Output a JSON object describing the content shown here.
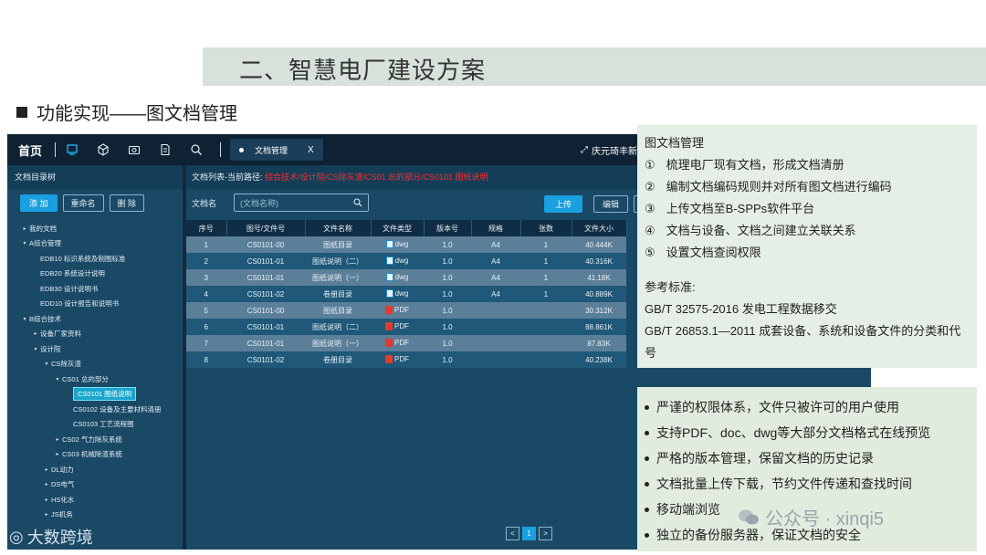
{
  "slide": {
    "title": "二、智慧电厂建设方案",
    "section": "功能实现——图文档管理"
  },
  "app": {
    "home_label": "首页",
    "tab_label": "文档管理",
    "tab_close": "X",
    "user_label": "庆元琦丰新",
    "left_panel": {
      "title": "文档目录树",
      "buttons": {
        "add": "添 加",
        "rename": "重命名",
        "delete": "删 除"
      },
      "tree": [
        {
          "label": "我的文档",
          "indent": 0,
          "arrow": "▸"
        },
        {
          "label": "A综合管理",
          "indent": 0,
          "arrow": "▾"
        },
        {
          "label": "EDB10 标识系统及制图标准",
          "indent": 1,
          "arrow": ""
        },
        {
          "label": "EDB20 系统设计说明",
          "indent": 1,
          "arrow": ""
        },
        {
          "label": "EDB30 设计说明书",
          "indent": 1,
          "arrow": ""
        },
        {
          "label": "EDD10 设计报告和说明书",
          "indent": 1,
          "arrow": ""
        },
        {
          "label": "B综合技术",
          "indent": 0,
          "arrow": "▾"
        },
        {
          "label": "设备厂家资料",
          "indent": 1,
          "arrow": "▸"
        },
        {
          "label": "设计院",
          "indent": 1,
          "arrow": "▾"
        },
        {
          "label": "CS除灰渣",
          "indent": 2,
          "arrow": "▾"
        },
        {
          "label": "CS01 总的部分",
          "indent": 3,
          "arrow": "▾"
        },
        {
          "label": "CS0101 图纸说明",
          "indent": 4,
          "arrow": "",
          "selected": true
        },
        {
          "label": "CS0102 设备及主要材料清册",
          "indent": 4,
          "arrow": ""
        },
        {
          "label": "CS0103 工艺流程图",
          "indent": 4,
          "arrow": ""
        },
        {
          "label": "CS02 气力除灰系统",
          "indent": 3,
          "arrow": "▸"
        },
        {
          "label": "CS03 机械除渣系统",
          "indent": 3,
          "arrow": "▸"
        },
        {
          "label": "DL动力",
          "indent": 2,
          "arrow": "▸"
        },
        {
          "label": "DS电气",
          "indent": 2,
          "arrow": "▸"
        },
        {
          "label": "HS化水",
          "indent": 2,
          "arrow": "▸"
        },
        {
          "label": "JS机务",
          "indent": 2,
          "arrow": "▸"
        }
      ]
    },
    "right_panel": {
      "header_prefix": "文档列表-当前路径:",
      "header_path": "综合技术/设计院/CS除灰渣/CS01 总的部分/CS0101 图纸说明",
      "search_label": "文档名",
      "search_placeholder": "(文档名称)",
      "upload_label": "上传",
      "edit_label": "编辑",
      "columns": [
        "序号",
        "图号/文件号",
        "文件名称",
        "文件类型",
        "版本号",
        "规格",
        "张数",
        "文件大小"
      ],
      "rows": [
        {
          "no": "1",
          "code": "CS0101-00",
          "name": "图纸目录",
          "type": "dwg",
          "ver": "1.0",
          "spec": "A4",
          "pages": "1",
          "size": "40.444K"
        },
        {
          "no": "2",
          "code": "CS0101-01",
          "name": "图纸说明（二）",
          "type": "dwg",
          "ver": "1.0",
          "spec": "A4",
          "pages": "1",
          "size": "40.316K"
        },
        {
          "no": "3",
          "code": "CS0101-01",
          "name": "图纸说明（一）",
          "type": "dwg",
          "ver": "1.0",
          "spec": "A4",
          "pages": "1",
          "size": "41.18K"
        },
        {
          "no": "4",
          "code": "CS0101-02",
          "name": "卷册目录",
          "type": "dwg",
          "ver": "1.0",
          "spec": "A4",
          "pages": "1",
          "size": "40.889K"
        },
        {
          "no": "5",
          "code": "CS0101-00",
          "name": "图纸目录",
          "type": "PDF",
          "ver": "1.0",
          "spec": "",
          "pages": "",
          "size": "30.312K"
        },
        {
          "no": "6",
          "code": "CS0101-01",
          "name": "图纸说明（二）",
          "type": "PDF",
          "ver": "1.0",
          "spec": "",
          "pages": "",
          "size": "88.861K"
        },
        {
          "no": "7",
          "code": "CS0101-01",
          "name": "图纸说明（一）",
          "type": "PDF",
          "ver": "1.0",
          "spec": "",
          "pages": "",
          "size": "87.83K"
        },
        {
          "no": "8",
          "code": "CS0101-02",
          "name": "卷册目录",
          "type": "PDF",
          "ver": "1.0",
          "spec": "",
          "pages": "",
          "size": "40.238K"
        }
      ],
      "pager": {
        "prev": "<",
        "current": "1",
        "next": ">"
      }
    }
  },
  "info": {
    "title": "图文档管理",
    "items": [
      {
        "num": "①",
        "text": "梳理电厂现有文档，形成文档清册"
      },
      {
        "num": "②",
        "text": "编制文档编码规则并对所有图文档进行编码"
      },
      {
        "num": "③",
        "text": "上传文档至B-SPPs软件平台"
      },
      {
        "num": "④",
        "text": "文档与设备、文档之间建立关联关系"
      },
      {
        "num": "⑤",
        "text": "设置文档查阅权限"
      }
    ],
    "ref_title": "参考标准:",
    "refs": [
      "GB/T 32575-2016 发电工程数据移交",
      "GB/T 26853.1—2011 成套设备、系统和设备文件的分类和代号"
    ]
  },
  "features": [
    "严谨的权限体系，文件只被许可的用户使用",
    "支持PDF、doc、dwg等大部分文档格式在线预览",
    "严格的版本管理，保留文档的历史记录",
    "文档批量上传下载，节约文件传递和查找时间",
    "移动端浏览",
    "独立的备份服务器，保证文档的安全"
  ],
  "watermarks": {
    "left": "大数跨境",
    "right": "公众号 · xinqi5"
  }
}
